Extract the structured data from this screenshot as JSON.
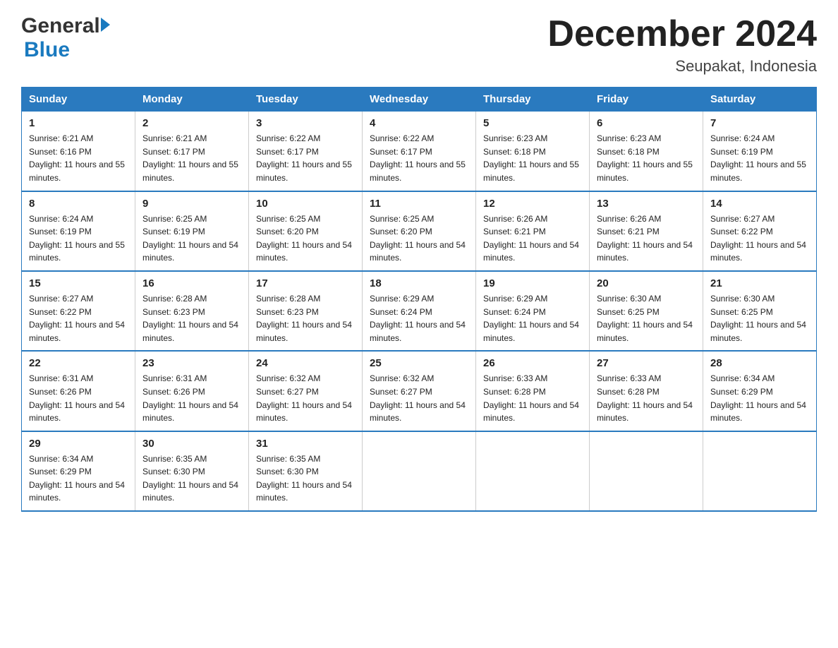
{
  "header": {
    "logo_general": "General",
    "logo_blue": "Blue",
    "month_title": "December 2024",
    "location": "Seupakat, Indonesia"
  },
  "days_of_week": [
    "Sunday",
    "Monday",
    "Tuesday",
    "Wednesday",
    "Thursday",
    "Friday",
    "Saturday"
  ],
  "weeks": [
    [
      {
        "day": "1",
        "sunrise": "6:21 AM",
        "sunset": "6:16 PM",
        "daylight": "11 hours and 55 minutes."
      },
      {
        "day": "2",
        "sunrise": "6:21 AM",
        "sunset": "6:17 PM",
        "daylight": "11 hours and 55 minutes."
      },
      {
        "day": "3",
        "sunrise": "6:22 AM",
        "sunset": "6:17 PM",
        "daylight": "11 hours and 55 minutes."
      },
      {
        "day": "4",
        "sunrise": "6:22 AM",
        "sunset": "6:17 PM",
        "daylight": "11 hours and 55 minutes."
      },
      {
        "day": "5",
        "sunrise": "6:23 AM",
        "sunset": "6:18 PM",
        "daylight": "11 hours and 55 minutes."
      },
      {
        "day": "6",
        "sunrise": "6:23 AM",
        "sunset": "6:18 PM",
        "daylight": "11 hours and 55 minutes."
      },
      {
        "day": "7",
        "sunrise": "6:24 AM",
        "sunset": "6:19 PM",
        "daylight": "11 hours and 55 minutes."
      }
    ],
    [
      {
        "day": "8",
        "sunrise": "6:24 AM",
        "sunset": "6:19 PM",
        "daylight": "11 hours and 55 minutes."
      },
      {
        "day": "9",
        "sunrise": "6:25 AM",
        "sunset": "6:19 PM",
        "daylight": "11 hours and 54 minutes."
      },
      {
        "day": "10",
        "sunrise": "6:25 AM",
        "sunset": "6:20 PM",
        "daylight": "11 hours and 54 minutes."
      },
      {
        "day": "11",
        "sunrise": "6:25 AM",
        "sunset": "6:20 PM",
        "daylight": "11 hours and 54 minutes."
      },
      {
        "day": "12",
        "sunrise": "6:26 AM",
        "sunset": "6:21 PM",
        "daylight": "11 hours and 54 minutes."
      },
      {
        "day": "13",
        "sunrise": "6:26 AM",
        "sunset": "6:21 PM",
        "daylight": "11 hours and 54 minutes."
      },
      {
        "day": "14",
        "sunrise": "6:27 AM",
        "sunset": "6:22 PM",
        "daylight": "11 hours and 54 minutes."
      }
    ],
    [
      {
        "day": "15",
        "sunrise": "6:27 AM",
        "sunset": "6:22 PM",
        "daylight": "11 hours and 54 minutes."
      },
      {
        "day": "16",
        "sunrise": "6:28 AM",
        "sunset": "6:23 PM",
        "daylight": "11 hours and 54 minutes."
      },
      {
        "day": "17",
        "sunrise": "6:28 AM",
        "sunset": "6:23 PM",
        "daylight": "11 hours and 54 minutes."
      },
      {
        "day": "18",
        "sunrise": "6:29 AM",
        "sunset": "6:24 PM",
        "daylight": "11 hours and 54 minutes."
      },
      {
        "day": "19",
        "sunrise": "6:29 AM",
        "sunset": "6:24 PM",
        "daylight": "11 hours and 54 minutes."
      },
      {
        "day": "20",
        "sunrise": "6:30 AM",
        "sunset": "6:25 PM",
        "daylight": "11 hours and 54 minutes."
      },
      {
        "day": "21",
        "sunrise": "6:30 AM",
        "sunset": "6:25 PM",
        "daylight": "11 hours and 54 minutes."
      }
    ],
    [
      {
        "day": "22",
        "sunrise": "6:31 AM",
        "sunset": "6:26 PM",
        "daylight": "11 hours and 54 minutes."
      },
      {
        "day": "23",
        "sunrise": "6:31 AM",
        "sunset": "6:26 PM",
        "daylight": "11 hours and 54 minutes."
      },
      {
        "day": "24",
        "sunrise": "6:32 AM",
        "sunset": "6:27 PM",
        "daylight": "11 hours and 54 minutes."
      },
      {
        "day": "25",
        "sunrise": "6:32 AM",
        "sunset": "6:27 PM",
        "daylight": "11 hours and 54 minutes."
      },
      {
        "day": "26",
        "sunrise": "6:33 AM",
        "sunset": "6:28 PM",
        "daylight": "11 hours and 54 minutes."
      },
      {
        "day": "27",
        "sunrise": "6:33 AM",
        "sunset": "6:28 PM",
        "daylight": "11 hours and 54 minutes."
      },
      {
        "day": "28",
        "sunrise": "6:34 AM",
        "sunset": "6:29 PM",
        "daylight": "11 hours and 54 minutes."
      }
    ],
    [
      {
        "day": "29",
        "sunrise": "6:34 AM",
        "sunset": "6:29 PM",
        "daylight": "11 hours and 54 minutes."
      },
      {
        "day": "30",
        "sunrise": "6:35 AM",
        "sunset": "6:30 PM",
        "daylight": "11 hours and 54 minutes."
      },
      {
        "day": "31",
        "sunrise": "6:35 AM",
        "sunset": "6:30 PM",
        "daylight": "11 hours and 54 minutes."
      },
      null,
      null,
      null,
      null
    ]
  ]
}
